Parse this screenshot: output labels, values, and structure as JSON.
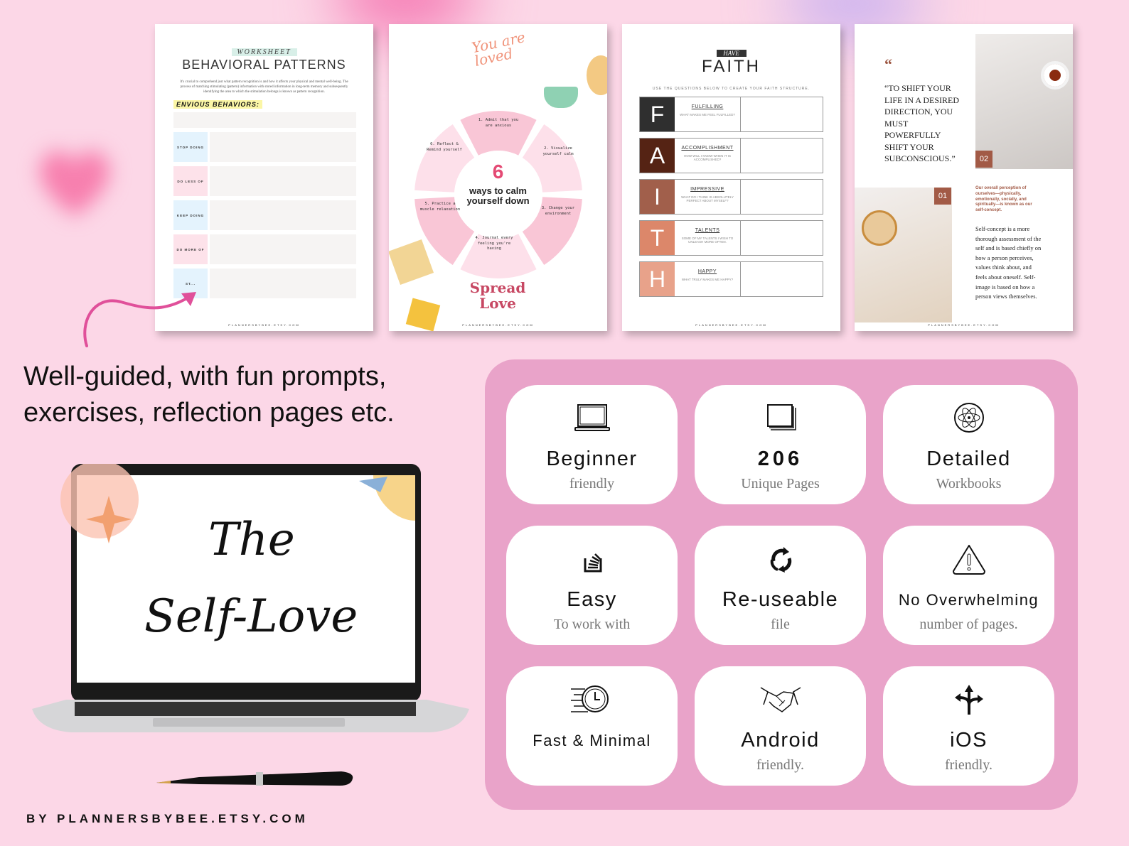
{
  "pages": {
    "worksheet": {
      "tag": "WORKSHEET",
      "title": "BEHAVIORAL PATTERNS",
      "intro": "It's crucial to comprehend just what pattern recognition is and how it affects your physical and mental well-being. The process of matching stimulating (pattern) information with stored information in long-term memory and subsequently identifying the area to which the stimulation belongs is known as pattern recognition.",
      "section": "ENVIOUS BEHAVIORS:",
      "rows": [
        "STOP DOING",
        "DO LESS OF",
        "KEEP DOING",
        "DO MORE OF",
        "ST..."
      ],
      "footer": "PLANNERSBYBEE.ETSY.COM"
    },
    "calm": {
      "script": "You are loved",
      "number": "6",
      "title": "ways to calm yourself down",
      "steps": [
        "1. Admit that you are anxious",
        "2. Visualize yourself calm",
        "3. Change your environment",
        "4. Journal every feeling you're having",
        "5. Practice a muscle relaxation",
        "6. Reflect & Remind yourself"
      ],
      "sticker": "Spread Love",
      "footer": "PLANNERSBYBEE.ETSY.COM"
    },
    "faith": {
      "tag": "HAVE",
      "title": "FAITH",
      "instruction": "USE THE QUESTIONS BELOW TO CREATE YOUR FAITH STRUCTURE.",
      "rows": [
        {
          "letter": "F",
          "word": "FULFILLING",
          "question": "WHAT MAKES ME FEEL FULFILLED?",
          "color": "#2f2f2f"
        },
        {
          "letter": "A",
          "word": "ACCOMPLISHMENT",
          "question": "HOW WILL I KNOW WHEN IT IS ACCOMPLISHED?",
          "color": "#552314"
        },
        {
          "letter": "I",
          "word": "IMPRESSIVE",
          "question": "WHAT DO I THINK IS ABSOLUTELY PERFECT ABOUT MYSELF?",
          "color": "#a15f4b"
        },
        {
          "letter": "T",
          "word": "TALENTS",
          "question": "SOME OF MY TALENTS I WISH TO UNLEASH MORE OFTEN.",
          "color": "#dc876a"
        },
        {
          "letter": "H",
          "word": "HAPPY",
          "question": "WHAT TRULY MAKES ME HAPPY?",
          "color": "#e8a28a"
        }
      ],
      "footer": "PLANNERSBYBEE.ETSY.COM"
    },
    "concept": {
      "quote_mark": "“",
      "quote": "“TO SHIFT YOUR LIFE IN A DESIRED DIRECTION, YOU MUST POWERFULLY SHIFT YOUR SUBCONSCIOUS.”",
      "badge1": "01",
      "badge2": "02",
      "lead": "Our overall perception of ourselves—physically, emotionally, socially, and spiritually—is known as our self-concept.",
      "body": "Self-concept is a more thorough assessment of the self and is based chiefly on how a person perceives, values think about, and feels about oneself. Self-image is based on how a person views themselves.",
      "footer": "PLANNERSBYBEE.ETSY.COM"
    }
  },
  "headline": {
    "line1": "Well-guided, with fun prompts,",
    "line2": "exercises, reflection pages etc."
  },
  "laptop": {
    "line1": "The",
    "line2": "Self-Love"
  },
  "features": [
    {
      "icon": "laptop-icon",
      "title": "Beginner",
      "subtitle": "friendly"
    },
    {
      "icon": "pages-stack-icon",
      "title": "206",
      "subtitle": "Unique Pages"
    },
    {
      "icon": "atom-icon",
      "title": "Detailed",
      "subtitle": "Workbooks"
    },
    {
      "icon": "stack-icon",
      "title": "Easy",
      "subtitle": "To work with"
    },
    {
      "icon": "recycle-icon",
      "title": "Re-useable",
      "subtitle": "file"
    },
    {
      "icon": "warning-icon",
      "title": "No Overwhelming",
      "subtitle": "number of pages."
    },
    {
      "icon": "fast-clock-icon",
      "title": "Fast & Minimal",
      "subtitle": ""
    },
    {
      "icon": "handshake-icon",
      "title": "Android",
      "subtitle": "friendly."
    },
    {
      "icon": "directions-icon",
      "title": "iOS",
      "subtitle": "friendly."
    }
  ],
  "footer": "BY PLANNERSBYBEE.ETSY.COM",
  "colors": {
    "background": "#fcd7e7",
    "panel": "#e9a3c9",
    "accent_pink": "#e44a74",
    "brown": "#a25a46"
  }
}
